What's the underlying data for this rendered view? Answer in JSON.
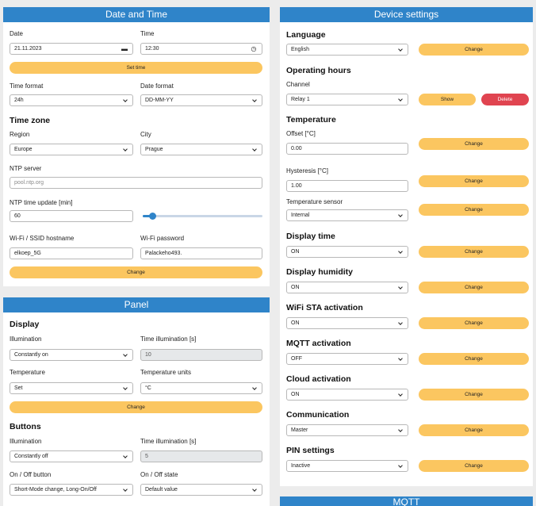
{
  "date_time": {
    "title": "Date and Time",
    "date_label": "Date",
    "date_value": "21.11.2023",
    "time_label": "Time",
    "time_value": "12:30",
    "set_time_button": "Set time",
    "time_format_label": "Time format",
    "time_format_value": "24h",
    "date_format_label": "Date format",
    "date_format_value": "DD-MM-YY",
    "time_zone_heading": "Time zone",
    "region_label": "Region",
    "region_value": "Europe",
    "city_label": "City",
    "city_value": "Prague",
    "ntp_server_label": "NTP server",
    "ntp_server_placeholder": "pool.ntp.org",
    "ntp_update_label": "NTP time update [min]",
    "ntp_update_value": "60",
    "ntp_slider_fraction": 0.05,
    "wifi_ssid_label": "Wi-Fi / SSID hostname",
    "wifi_ssid_value": "elkoep_5G",
    "wifi_password_label": "Wi-Fi password",
    "wifi_password_value": "Palackeho493.",
    "change_button": "Change"
  },
  "panel": {
    "title": "Panel",
    "display_heading": "Display",
    "illumination_label": "Illumination",
    "illumination_value": "Constantly on",
    "time_illumination_label": "Time illumination [s]",
    "time_illumination_value": "10",
    "temperature_label": "Temperature",
    "temperature_value": "Set",
    "temperature_units_label": "Temperature units",
    "temperature_units_value": "°C",
    "change_button": "Change",
    "buttons_heading": "Buttons",
    "btn_illumination_label": "Illumination",
    "btn_illumination_value": "Constantly off",
    "btn_time_illumination_label": "Time illumination [s]",
    "btn_time_illumination_value": "5",
    "onoff_button_label": "On / Off button",
    "onoff_button_value": "Short-Mode change, Long-On/Off",
    "onoff_state_label": "On / Off state",
    "onoff_state_value": "Default value"
  },
  "device": {
    "title": "Device settings",
    "language_heading": "Language",
    "language_value": "English",
    "operating_hours_heading": "Operating hours",
    "channel_label": "Channel",
    "channel_value": "Relay 1",
    "show_button": "Show",
    "delete_button": "Delete",
    "temperature_heading": "Temperature",
    "offset_label": "Offset [°C]",
    "offset_value": "0.00",
    "hysteresis_label": "Hysteresis [°C]",
    "hysteresis_value": "1.00",
    "temp_sensor_label": "Temperature sensor",
    "temp_sensor_value": "Internal",
    "display_time_heading": "Display time",
    "display_time_value": "ON",
    "display_humidity_heading": "Display humidity",
    "display_humidity_value": "ON",
    "wifi_sta_heading": "WiFi STA activation",
    "wifi_sta_value": "ON",
    "mqtt_activation_heading": "MQTT activation",
    "mqtt_activation_value": "OFF",
    "cloud_heading": "Cloud activation",
    "cloud_value": "ON",
    "communication_heading": "Communication",
    "communication_value": "Master",
    "pin_heading": "PIN settings",
    "pin_value": "Inactive",
    "change_button": "Change"
  },
  "mqtt": {
    "title": "MQTT"
  },
  "icons": {
    "calendar": "calendar-icon",
    "clock": "clock-icon",
    "chevron": "chevron-down-icon"
  },
  "colors": {
    "header": "#2f84c9",
    "button": "#fbc660",
    "delete": "#e04450"
  }
}
